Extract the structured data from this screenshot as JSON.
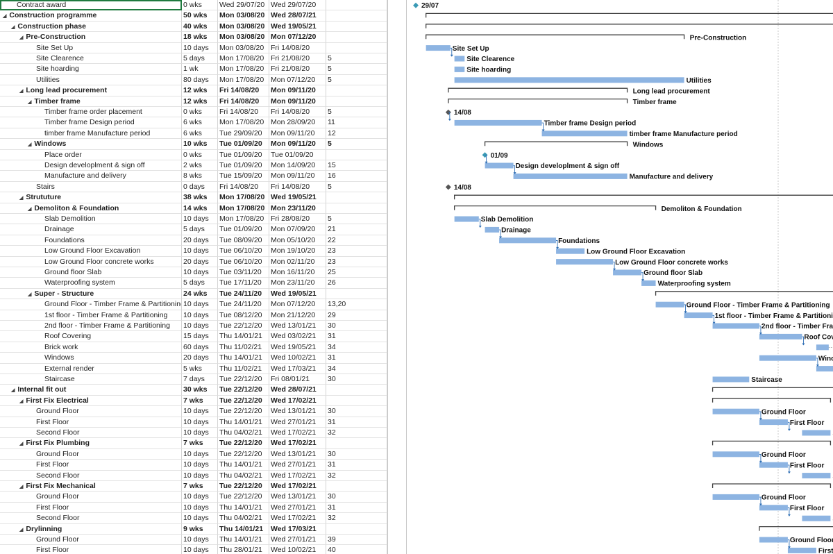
{
  "colors": {
    "bar": "#8db4e2",
    "summary": "#404040",
    "milestone_diamond": "#3a9ab5",
    "milestone_dark": "#555555",
    "link": "#2f6fb5",
    "selection": "#1f7a3f"
  },
  "tasks": [
    {
      "name": "Contract award",
      "level": 0,
      "summary": false,
      "dur": "0 wks",
      "start": "Wed 29/07/20",
      "finish": "Wed 29/07/20",
      "pred": "",
      "selected": true,
      "bar": {
        "type": "milestone",
        "label": "29/07"
      }
    },
    {
      "name": "Construction programme",
      "level": 0,
      "summary": true,
      "dur": "50 wks",
      "start": "Mon 03/08/20",
      "finish": "Wed 28/07/21",
      "pred": "",
      "bar": {
        "type": "summary",
        "label": "Construction programme"
      }
    },
    {
      "name": "Construction phase",
      "level": 1,
      "summary": true,
      "dur": "40 wks",
      "start": "Mon 03/08/20",
      "finish": "Wed 19/05/21",
      "pred": "",
      "bar": {
        "type": "summary",
        "label": "Construction phase"
      }
    },
    {
      "name": "Pre-Construction",
      "level": 2,
      "summary": true,
      "dur": "18 wks",
      "start": "Mon 03/08/20",
      "finish": "Mon 07/12/20",
      "pred": "",
      "bar": {
        "type": "summary",
        "label": "Pre-Construction"
      }
    },
    {
      "name": "Site Set Up",
      "level": 3,
      "summary": false,
      "dur": "10 days",
      "start": "Mon 03/08/20",
      "finish": "Fri 14/08/20",
      "pred": "",
      "bar": {
        "type": "task",
        "label": "Site Set Up"
      }
    },
    {
      "name": "Site Clearence",
      "level": 3,
      "summary": false,
      "dur": "5 days",
      "start": "Mon 17/08/20",
      "finish": "Fri 21/08/20",
      "pred": "5",
      "bar": {
        "type": "task",
        "label": "Site Clearence"
      }
    },
    {
      "name": "Site hoarding",
      "level": 3,
      "summary": false,
      "dur": "1 wk",
      "start": "Mon 17/08/20",
      "finish": "Fri 21/08/20",
      "pred": "5",
      "bar": {
        "type": "task",
        "label": "Site hoarding"
      }
    },
    {
      "name": "Utilities",
      "level": 3,
      "summary": false,
      "dur": "80 days",
      "start": "Mon 17/08/20",
      "finish": "Mon 07/12/20",
      "pred": "5",
      "bar": {
        "type": "task",
        "label": "Utilities"
      }
    },
    {
      "name": "Long lead procurement",
      "level": 2,
      "summary": true,
      "dur": "12 wks",
      "start": "Fri 14/08/20",
      "finish": "Mon 09/11/20",
      "pred": "",
      "bar": {
        "type": "summary",
        "label": "Long lead procurement"
      }
    },
    {
      "name": "Timber frame",
      "level": 3,
      "summary": true,
      "dur": "12 wks",
      "start": "Fri 14/08/20",
      "finish": "Mon 09/11/20",
      "pred": "",
      "bar": {
        "type": "summary",
        "label": "Timber frame"
      }
    },
    {
      "name": "Timber frame order placement",
      "level": 4,
      "summary": false,
      "dur": "0 wks",
      "start": "Fri 14/08/20",
      "finish": "Fri 14/08/20",
      "pred": "5",
      "bar": {
        "type": "milestone-dark",
        "label": "14/08"
      }
    },
    {
      "name": "Timber frame Design period",
      "level": 4,
      "summary": false,
      "dur": "6 wks",
      "start": "Mon 17/08/20",
      "finish": "Mon 28/09/20",
      "pred": "11",
      "bar": {
        "type": "task",
        "label": "Timber frame Design period"
      }
    },
    {
      "name": "timber frame Manufacture period",
      "level": 4,
      "summary": false,
      "dur": "6 wks",
      "start": "Tue 29/09/20",
      "finish": "Mon 09/11/20",
      "pred": "12",
      "bar": {
        "type": "task",
        "label": "timber frame Manufacture period"
      }
    },
    {
      "name": "Windows",
      "level": 3,
      "summary": true,
      "dur": "10 wks",
      "start": "Tue 01/09/20",
      "finish": "Mon 09/11/20",
      "pred": "5",
      "bar": {
        "type": "summary",
        "label": "Windows"
      }
    },
    {
      "name": "Place order",
      "level": 4,
      "summary": false,
      "dur": "0 wks",
      "start": "Tue 01/09/20",
      "finish": "Tue 01/09/20",
      "pred": "",
      "bar": {
        "type": "milestone",
        "label": "01/09"
      }
    },
    {
      "name": "Design developlment  & sign off",
      "level": 4,
      "summary": false,
      "dur": "2 wks",
      "start": "Tue 01/09/20",
      "finish": "Mon 14/09/20",
      "pred": "15",
      "bar": {
        "type": "task",
        "label": "Design developlment  & sign off"
      }
    },
    {
      "name": "Manufacture and delivery",
      "level": 4,
      "summary": false,
      "dur": "8 wks",
      "start": "Tue 15/09/20",
      "finish": "Mon 09/11/20",
      "pred": "16",
      "bar": {
        "type": "task",
        "label": "Manufacture and delivery"
      }
    },
    {
      "name": "Stairs",
      "level": 3,
      "summary": false,
      "dur": "0 days",
      "start": "Fri 14/08/20",
      "finish": "Fri 14/08/20",
      "pred": "5",
      "bar": {
        "type": "milestone-dark",
        "label": "14/08"
      }
    },
    {
      "name": "Strututure",
      "level": 2,
      "summary": true,
      "dur": "38 wks",
      "start": "Mon 17/08/20",
      "finish": "Wed 19/05/21",
      "pred": "",
      "bar": {
        "type": "summary",
        "label": "Strututure"
      }
    },
    {
      "name": "Demoliton & Foundation",
      "level": 3,
      "summary": true,
      "dur": "14 wks",
      "start": "Mon 17/08/20",
      "finish": "Mon 23/11/20",
      "pred": "",
      "bar": {
        "type": "summary",
        "label": "Demoliton & Foundation"
      }
    },
    {
      "name": "Slab Demolition",
      "level": 4,
      "summary": false,
      "dur": "10 days",
      "start": "Mon 17/08/20",
      "finish": "Fri 28/08/20",
      "pred": "5",
      "bar": {
        "type": "task",
        "label": "Slab Demolition"
      }
    },
    {
      "name": "Drainage",
      "level": 4,
      "summary": false,
      "dur": "5 days",
      "start": "Tue 01/09/20",
      "finish": "Mon 07/09/20",
      "pred": "21",
      "bar": {
        "type": "task",
        "label": "Drainage"
      }
    },
    {
      "name": "Foundations",
      "level": 4,
      "summary": false,
      "dur": "20 days",
      "start": "Tue 08/09/20",
      "finish": "Mon 05/10/20",
      "pred": "22",
      "bar": {
        "type": "task",
        "label": "Foundations"
      }
    },
    {
      "name": "Low Ground Floor Excavation",
      "level": 4,
      "summary": false,
      "dur": "10 days",
      "start": "Tue 06/10/20",
      "finish": "Mon 19/10/20",
      "pred": "23",
      "bar": {
        "type": "task",
        "label": "Low Ground Floor Excavation"
      }
    },
    {
      "name": "Low Ground Floor concrete works",
      "level": 4,
      "summary": false,
      "dur": "20 days",
      "start": "Tue 06/10/20",
      "finish": "Mon 02/11/20",
      "pred": "23",
      "bar": {
        "type": "task",
        "label": "Low Ground Floor concrete works"
      }
    },
    {
      "name": "Ground floor Slab",
      "level": 4,
      "summary": false,
      "dur": "10 days",
      "start": "Tue 03/11/20",
      "finish": "Mon 16/11/20",
      "pred": "25",
      "bar": {
        "type": "task",
        "label": "Ground floor Slab"
      }
    },
    {
      "name": "Waterproofing system",
      "level": 4,
      "summary": false,
      "dur": "5 days",
      "start": "Tue 17/11/20",
      "finish": "Mon 23/11/20",
      "pred": "26",
      "bar": {
        "type": "task",
        "label": "Waterproofing system"
      }
    },
    {
      "name": "Super - Structure",
      "level": 3,
      "summary": true,
      "dur": "24 wks",
      "start": "Tue 24/11/20",
      "finish": "Wed 19/05/21",
      "pred": "",
      "bar": {
        "type": "summary",
        "label": "Super - Structure"
      }
    },
    {
      "name": "Ground Floor - Timber Frame & Partitioning",
      "level": 4,
      "summary": false,
      "dur": "10 days",
      "start": "Tue 24/11/20",
      "finish": "Mon 07/12/20",
      "pred": "13,20",
      "bar": {
        "type": "task",
        "label": "Ground Floor - Timber Frame & Partitioning"
      }
    },
    {
      "name": "1st floor - Timber Frame & Partitioning",
      "level": 4,
      "summary": false,
      "dur": "10 days",
      "start": "Tue 08/12/20",
      "finish": "Mon 21/12/20",
      "pred": "29",
      "bar": {
        "type": "task",
        "label": "1st floor - Timber Frame & Partitioning"
      }
    },
    {
      "name": "2nd floor - Timber Frame & Partitioning",
      "level": 4,
      "summary": false,
      "dur": "10 days",
      "start": "Tue 22/12/20",
      "finish": "Wed 13/01/21",
      "pred": "30",
      "bar": {
        "type": "task",
        "label": "2nd floor - Timber Frame & Partitioning"
      }
    },
    {
      "name": "Roof Covering",
      "level": 4,
      "summary": false,
      "dur": "15 days",
      "start": "Thu 14/01/21",
      "finish": "Wed 03/02/21",
      "pred": "31",
      "bar": {
        "type": "task",
        "label": "Roof Covering"
      }
    },
    {
      "name": "Brick work",
      "level": 4,
      "summary": false,
      "dur": "60 days",
      "start": "Thu 11/02/21",
      "finish": "Wed 19/05/21",
      "pred": "34",
      "bar": {
        "type": "task-split",
        "label": "Brick work"
      }
    },
    {
      "name": "Windows",
      "level": 4,
      "summary": false,
      "dur": "20 days",
      "start": "Thu 14/01/21",
      "finish": "Wed 10/02/21",
      "pred": "31",
      "bar": {
        "type": "task",
        "label": "Windows"
      }
    },
    {
      "name": "External render",
      "level": 4,
      "summary": false,
      "dur": "5 wks",
      "start": "Thu 11/02/21",
      "finish": "Wed 17/03/21",
      "pred": "34",
      "bar": {
        "type": "task",
        "label": "External render"
      }
    },
    {
      "name": "Staircase",
      "level": 4,
      "summary": false,
      "dur": "7 days",
      "start": "Tue 22/12/20",
      "finish": "Fri 08/01/21",
      "pred": "30",
      "bar": {
        "type": "task",
        "label": "Staircase"
      }
    },
    {
      "name": "Internal fit out",
      "level": 1,
      "summary": true,
      "dur": "30 wks",
      "start": "Tue 22/12/20",
      "finish": "Wed 28/07/21",
      "pred": "",
      "bar": {
        "type": "summary",
        "label": "Internal fit out"
      }
    },
    {
      "name": "First Fix Electrical",
      "level": 2,
      "summary": true,
      "dur": "7 wks",
      "start": "Tue 22/12/20",
      "finish": "Wed 17/02/21",
      "pred": "",
      "bar": {
        "type": "summary",
        "label": "First Fix Electrical"
      }
    },
    {
      "name": "Ground Floor",
      "level": 3,
      "summary": false,
      "dur": "10 days",
      "start": "Tue 22/12/20",
      "finish": "Wed 13/01/21",
      "pred": "30",
      "bar": {
        "type": "task",
        "label": "Ground Floor"
      }
    },
    {
      "name": "First Floor",
      "level": 3,
      "summary": false,
      "dur": "10 days",
      "start": "Thu 14/01/21",
      "finish": "Wed 27/01/21",
      "pred": "31",
      "bar": {
        "type": "task",
        "label": "First Floor"
      }
    },
    {
      "name": "Second Floor",
      "level": 3,
      "summary": false,
      "dur": "10 days",
      "start": "Thu 04/02/21",
      "finish": "Wed 17/02/21",
      "pred": "32",
      "bar": {
        "type": "task",
        "label": "Second Floor"
      }
    },
    {
      "name": "First Fix Plumbing",
      "level": 2,
      "summary": true,
      "dur": "7 wks",
      "start": "Tue 22/12/20",
      "finish": "Wed 17/02/21",
      "pred": "",
      "bar": {
        "type": "summary",
        "label": "First Fix Plumbing"
      }
    },
    {
      "name": "Ground Floor",
      "level": 3,
      "summary": false,
      "dur": "10 days",
      "start": "Tue 22/12/20",
      "finish": "Wed 13/01/21",
      "pred": "30",
      "bar": {
        "type": "task",
        "label": "Ground Floor"
      }
    },
    {
      "name": "First Floor",
      "level": 3,
      "summary": false,
      "dur": "10 days",
      "start": "Thu 14/01/21",
      "finish": "Wed 27/01/21",
      "pred": "31",
      "bar": {
        "type": "task",
        "label": "First Floor"
      }
    },
    {
      "name": "Second Floor",
      "level": 3,
      "summary": false,
      "dur": "10 days",
      "start": "Thu 04/02/21",
      "finish": "Wed 17/02/21",
      "pred": "32",
      "bar": {
        "type": "task",
        "label": "Second Floor"
      }
    },
    {
      "name": "First  Fix Mechanical",
      "level": 2,
      "summary": true,
      "dur": "7 wks",
      "start": "Tue 22/12/20",
      "finish": "Wed 17/02/21",
      "pred": "",
      "bar": {
        "type": "summary",
        "label": "First  Fix Mechanical"
      }
    },
    {
      "name": "Ground Floor",
      "level": 3,
      "summary": false,
      "dur": "10 days",
      "start": "Tue 22/12/20",
      "finish": "Wed 13/01/21",
      "pred": "30",
      "bar": {
        "type": "task",
        "label": "Ground Floor"
      }
    },
    {
      "name": "First Floor",
      "level": 3,
      "summary": false,
      "dur": "10 days",
      "start": "Thu 14/01/21",
      "finish": "Wed 27/01/21",
      "pred": "31",
      "bar": {
        "type": "task",
        "label": "First Floor"
      }
    },
    {
      "name": "Second Floor",
      "level": 3,
      "summary": false,
      "dur": "10 days",
      "start": "Thu 04/02/21",
      "finish": "Wed 17/02/21",
      "pred": "32",
      "bar": {
        "type": "task",
        "label": "Second Floor"
      }
    },
    {
      "name": "Drylinning",
      "level": 2,
      "summary": true,
      "dur": "9 wks",
      "start": "Thu 14/01/21",
      "finish": "Wed 17/03/21",
      "pred": "",
      "bar": {
        "type": "summary",
        "label": "Drylinning"
      }
    },
    {
      "name": "Ground Floor",
      "level": 3,
      "summary": false,
      "dur": "10 days",
      "start": "Thu 14/01/21",
      "finish": "Wed 27/01/21",
      "pred": "39",
      "bar": {
        "type": "task",
        "label": "Ground Floor"
      }
    },
    {
      "name": "First Floor",
      "level": 3,
      "summary": false,
      "dur": "10 days",
      "start": "Thu 28/01/21",
      "finish": "Wed 10/02/21",
      "pred": "40",
      "bar": {
        "type": "task",
        "label": "First Floor"
      }
    }
  ]
}
